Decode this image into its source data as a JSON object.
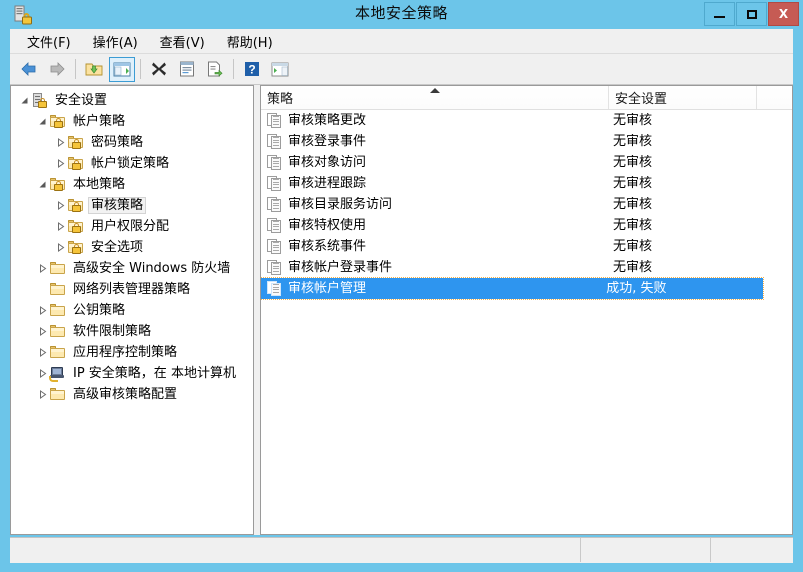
{
  "window": {
    "title": "本地安全策略",
    "icon": "security-settings-icon",
    "controls": {
      "minimize": "–",
      "maximize": "□",
      "close": "X"
    }
  },
  "menubar": {
    "items": [
      {
        "label": "文件(F)",
        "name": "menu-file"
      },
      {
        "label": "操作(A)",
        "name": "menu-action"
      },
      {
        "label": "查看(V)",
        "name": "menu-view"
      },
      {
        "label": "帮助(H)",
        "name": "menu-help"
      }
    ]
  },
  "toolbar": {
    "buttons": [
      {
        "name": "back-icon",
        "glyph": "←"
      },
      {
        "name": "forward-icon",
        "glyph": "→"
      },
      {
        "name": "up-folder-icon",
        "glyph": ""
      },
      {
        "name": "show-hide-tree-icon",
        "glyph": ""
      },
      {
        "name": "delete-icon",
        "glyph": "✖"
      },
      {
        "name": "properties-icon",
        "glyph": ""
      },
      {
        "name": "export-list-icon",
        "glyph": ""
      },
      {
        "name": "help-icon",
        "glyph": "?"
      },
      {
        "name": "show-action-pane-icon",
        "glyph": ""
      }
    ]
  },
  "tree": {
    "nodes": [
      {
        "label": "安全设置",
        "indent": 0,
        "expander": "expanded",
        "icon": "server-lock-icon",
        "selected": false,
        "has_expander": false
      },
      {
        "label": "帐户策略",
        "indent": 1,
        "expander": "expanded",
        "icon": "folder-lock-icon",
        "selected": false,
        "has_expander": true
      },
      {
        "label": "密码策略",
        "indent": 2,
        "expander": "collapsed",
        "icon": "folder-lock-icon",
        "selected": false,
        "has_expander": true
      },
      {
        "label": "帐户锁定策略",
        "indent": 2,
        "expander": "collapsed",
        "icon": "folder-lock-icon",
        "selected": false,
        "has_expander": true
      },
      {
        "label": "本地策略",
        "indent": 1,
        "expander": "expanded",
        "icon": "folder-lock-icon",
        "selected": false,
        "has_expander": true
      },
      {
        "label": "审核策略",
        "indent": 2,
        "expander": "collapsed",
        "icon": "folder-lock-icon",
        "selected": true,
        "has_expander": true
      },
      {
        "label": "用户权限分配",
        "indent": 2,
        "expander": "collapsed",
        "icon": "folder-lock-icon",
        "selected": false,
        "has_expander": true
      },
      {
        "label": "安全选项",
        "indent": 2,
        "expander": "collapsed",
        "icon": "folder-lock-icon",
        "selected": false,
        "has_expander": true
      },
      {
        "label": "高级安全 Windows 防火墙",
        "indent": 1,
        "expander": "collapsed",
        "icon": "folder-icon",
        "selected": false,
        "has_expander": true
      },
      {
        "label": "网络列表管理器策略",
        "indent": 1,
        "expander": "none",
        "icon": "folder-icon",
        "selected": false,
        "has_expander": false
      },
      {
        "label": "公钥策略",
        "indent": 1,
        "expander": "collapsed",
        "icon": "folder-icon",
        "selected": false,
        "has_expander": true
      },
      {
        "label": "软件限制策略",
        "indent": 1,
        "expander": "collapsed",
        "icon": "folder-icon",
        "selected": false,
        "has_expander": true
      },
      {
        "label": "应用程序控制策略",
        "indent": 1,
        "expander": "collapsed",
        "icon": "folder-icon",
        "selected": false,
        "has_expander": true
      },
      {
        "label": "IP 安全策略，在 本地计算机",
        "indent": 1,
        "expander": "collapsed",
        "icon": "ipsec-computer-icon",
        "selected": false,
        "has_expander": true
      },
      {
        "label": "高级审核策略配置",
        "indent": 1,
        "expander": "collapsed",
        "icon": "folder-icon",
        "selected": false,
        "has_expander": true
      }
    ]
  },
  "list": {
    "columns": [
      {
        "label": "策略",
        "name": "column-policy",
        "sorted": "asc"
      },
      {
        "label": "安全设置",
        "name": "column-setting",
        "sorted": ""
      },
      {
        "label": "",
        "name": "column-extra",
        "sorted": ""
      }
    ],
    "rows": [
      {
        "policy": "审核策略更改",
        "setting": "无审核",
        "selected": false
      },
      {
        "policy": "审核登录事件",
        "setting": "无审核",
        "selected": false
      },
      {
        "policy": "审核对象访问",
        "setting": "无审核",
        "selected": false
      },
      {
        "policy": "审核进程跟踪",
        "setting": "无审核",
        "selected": false
      },
      {
        "policy": "审核目录服务访问",
        "setting": "无审核",
        "selected": false
      },
      {
        "policy": "审核特权使用",
        "setting": "无审核",
        "selected": false
      },
      {
        "policy": "审核系统事件",
        "setting": "无审核",
        "selected": false
      },
      {
        "policy": "审核帐户登录事件",
        "setting": "无审核",
        "selected": false
      },
      {
        "policy": "审核帐户管理",
        "setting": "成功, 失败",
        "selected": true
      }
    ]
  },
  "statusbar": {
    "left": "",
    "middle": "",
    "right": ""
  },
  "colors": {
    "titlebar": "#6cc5e9",
    "close_button": "#c65b54",
    "selection": "#2e95ef",
    "chrome": "#f0f0f0"
  }
}
